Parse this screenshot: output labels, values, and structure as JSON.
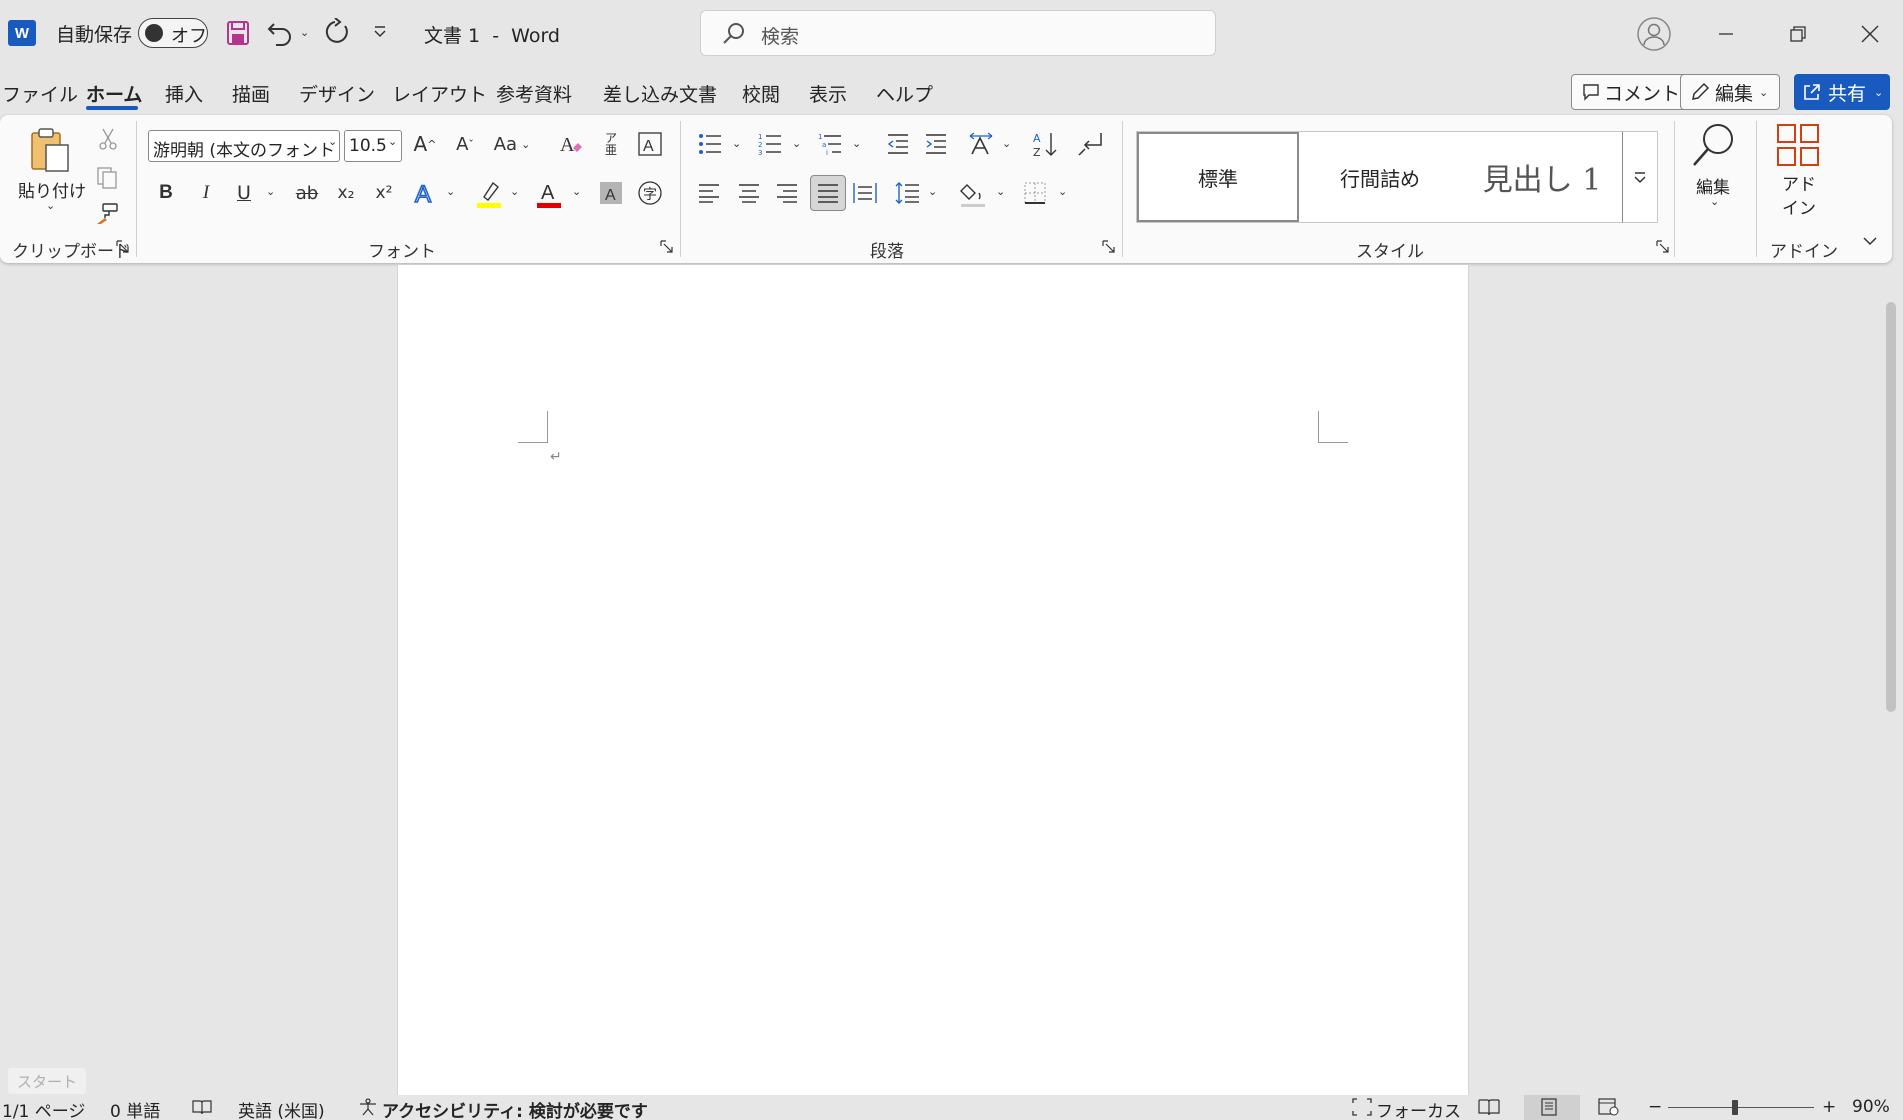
{
  "titlebar": {
    "app_logo": "W",
    "autosave_label": "自動保存",
    "autosave_state": "オフ",
    "document_title": "文書 1  -  Word",
    "search_placeholder": "検索"
  },
  "menu": {
    "tabs": [
      "ファイル",
      "ホーム",
      "挿入",
      "描画",
      "デザイン",
      "レイアウト",
      "参考資料",
      "差し込み文書",
      "校閲",
      "表示",
      "ヘルプ"
    ],
    "active_tab": "ホーム",
    "comment_label": "コメント",
    "edit_label": "編集",
    "share_label": "共有"
  },
  "ribbon": {
    "clipboard": {
      "label": "クリップボード",
      "paste_label": "貼り付け"
    },
    "font": {
      "label": "フォント",
      "font_name": "游明朝 (本文のフォント",
      "font_size": "10.5",
      "bold": "B",
      "italic": "I",
      "underline": "U",
      "strike": "ab",
      "subscript": "x₂",
      "superscript": "x²",
      "case_label": "Aa",
      "highlight_color": "#ffff00",
      "font_color": "#e00000"
    },
    "paragraph": {
      "label": "段落"
    },
    "styles": {
      "label": "スタイル",
      "items": [
        "標準",
        "行間詰め",
        "見出し 1"
      ]
    },
    "editing": {
      "label": "編集"
    },
    "addin": {
      "label": "アドイン",
      "button_label": "アド\nイン"
    }
  },
  "statusbar": {
    "page": "1/1 ページ",
    "words": "0 単語",
    "language": "英語 (米国)",
    "accessibility": "アクセシビリティ: 検討が必要です",
    "focus": "フォーカス",
    "zoom": "90%",
    "start_tooltip": "スタート"
  },
  "colors": {
    "accent": "#185abd",
    "ribbon_bg": "#fafafa",
    "app_bg": "#e6e6e6"
  }
}
